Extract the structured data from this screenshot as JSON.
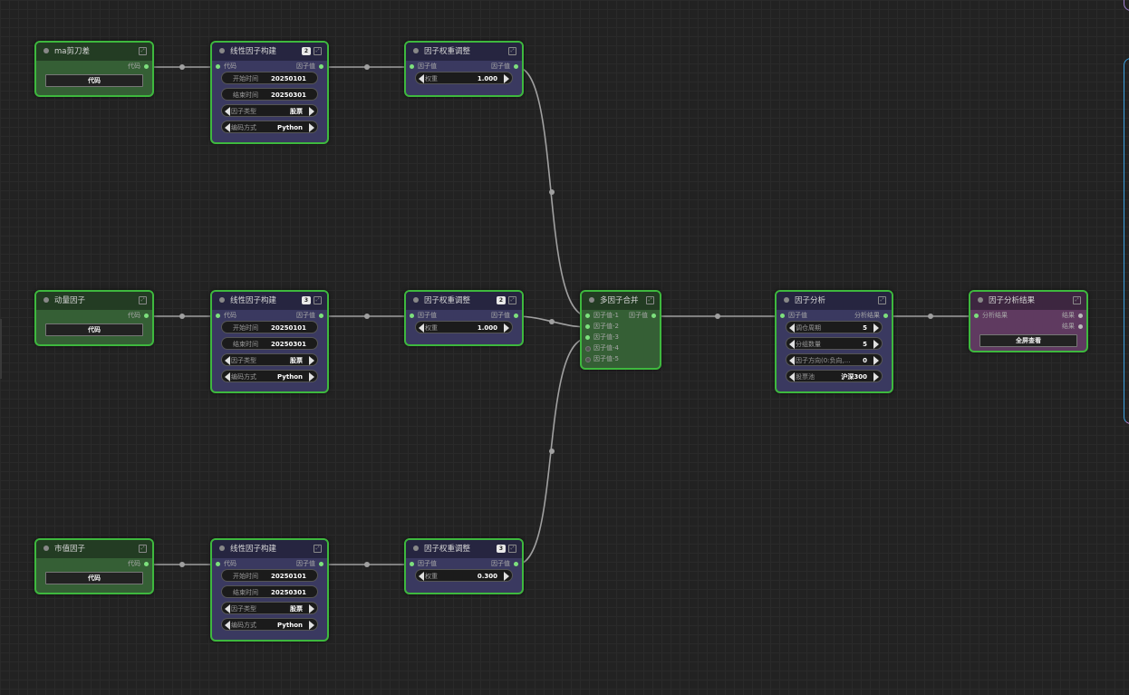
{
  "nodes": {
    "ma_cross": {
      "title": "ma剪刀差",
      "out": "代码",
      "button": "代码"
    },
    "momentum": {
      "title": "动量因子",
      "out": "代码",
      "button": "代码"
    },
    "market_cap": {
      "title": "市值因子",
      "out": "代码",
      "button": "代码"
    },
    "linear1": {
      "title": "线性因子构建",
      "badge": "2",
      "in": "代码",
      "out": "因子值",
      "start_label": "开始时间",
      "start": "20250101",
      "end_label": "结束时间",
      "end": "20250301",
      "type_label": "因子类型",
      "type": "股票",
      "code_label": "编码方式",
      "code": "Python"
    },
    "linear2": {
      "title": "线性因子构建",
      "badge": "3",
      "in": "代码",
      "out": "因子值",
      "start_label": "开始时间",
      "start": "20250101",
      "end_label": "结束时间",
      "end": "20250301",
      "type_label": "因子类型",
      "type": "股票",
      "code_label": "编码方式",
      "code": "Python"
    },
    "linear3": {
      "title": "线性因子构建",
      "in": "代码",
      "out": "因子值",
      "start_label": "开始时间",
      "start": "20250101",
      "end_label": "结束时间",
      "end": "20250301",
      "type_label": "因子类型",
      "type": "股票",
      "code_label": "编码方式",
      "code": "Python"
    },
    "weight1": {
      "title": "因子权重调整",
      "in": "因子值",
      "out": "因子值",
      "w_label": "权重",
      "w": "1.000"
    },
    "weight2": {
      "title": "因子权重调整",
      "badge": "2",
      "in": "因子值",
      "out": "因子值",
      "w_label": "权重",
      "w": "1.000"
    },
    "weight3": {
      "title": "因子权重调整",
      "badge": "3",
      "in": "因子值",
      "out": "因子值",
      "w_label": "权重",
      "w": "0.300"
    },
    "merge": {
      "title": "多因子合并",
      "out": "因子值",
      "in1": "因子值-1",
      "in2": "因子值-2",
      "in3": "因子值-3",
      "in4": "因子值-4",
      "in5": "因子值-5"
    },
    "analysis": {
      "title": "因子分析",
      "in": "因子值",
      "out": "分析结果",
      "p1_label": "调仓周期",
      "p1": "5",
      "p2_label": "分组数量",
      "p2": "5",
      "p3_label": "因子方向(0:负向,...",
      "p3": "0",
      "p4_label": "股票池",
      "p4": "沪深300"
    },
    "result": {
      "title": "因子分析结果",
      "in": "分析结果",
      "out1": "结果",
      "out2": "结果",
      "button": "全屏查看"
    }
  },
  "colors": {
    "link": "#a0a0a0",
    "node_border": "#3eb83e",
    "port": "#7de07d"
  }
}
